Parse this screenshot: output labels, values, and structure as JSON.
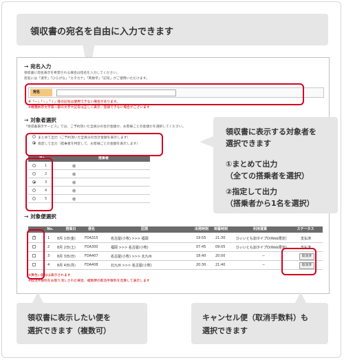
{
  "callouts": {
    "top": "領収書の宛名を自由に入力できます",
    "right": [
      "領収書に表示する対象者を",
      "選択できます",
      "①まとめて出力",
      "（全ての搭乗者を選択）",
      "②指定して出力",
      "（搭乗者から1名を選択）"
    ],
    "bottom_left": [
      "領収書に表示したい便を",
      "選択できます（複数可）"
    ],
    "bottom_right": [
      "キャンセル便（取消手数料）も",
      "選択できます"
    ]
  },
  "address_section": {
    "title": "宛名入力",
    "desc1": "領収書に宛名表示を希望される場合は宛名を入力してください。",
    "desc2": "宛名には「漢字」「ひらがな」「カタカナ」「英数字」「記号」がご使用いただけます。",
    "label": "宛名",
    "value": "",
    "note1": "※「ー」「ヽ」「ゞ」等の記号は使用できない場合があります。",
    "note2": "※機種依存文字等一部の文字や記号は正しく表示／登録できない場合がございます"
  },
  "recipient_section": {
    "title": "対象者選択",
    "desc": "「領収書表示サービス」では、ご予約頂いた全員分の合計金額か、お客様ごとの金額かを選択してください。",
    "option1": "まとめて出力（ご予約頂いた全員分の合計金額を表示します）",
    "option2": "指定して出力（搭乗者を特定して、お客様ごとの金額を表示します）",
    "header_no": "No.",
    "header_name": "搭乗者",
    "passengers": [
      {
        "no": "1",
        "name": "様",
        "selected": false
      },
      {
        "no": "2",
        "name": "様",
        "selected": false
      },
      {
        "no": "3",
        "name": "様",
        "selected": true
      },
      {
        "no": "4",
        "name": "様",
        "selected": false
      },
      {
        "no": "5",
        "name": "様",
        "selected": false
      }
    ]
  },
  "flight_section": {
    "title": "対象便選択",
    "headers": [
      "No.",
      "搭乗日",
      "便名",
      "区間",
      "出発時刻",
      "到着時刻",
      "利用運賃",
      "ステータス"
    ],
    "flights": [
      {
        "no": "1",
        "date": "8月 1日(金)",
        "flight": "FDA315",
        "route": "名古屋(小牧) >>> 福岡",
        "dep": "19:55",
        "arr": "21:30",
        "fare": "ひぃいとも割タイプD(Web限定)",
        "status": "支払済",
        "checked": true
      },
      {
        "no": "2",
        "date": "8月 2日(土)",
        "flight": "FDA300",
        "route": "福岡 >>> 名古屋(小牧)",
        "dep": "07:45",
        "arr": "09:05",
        "fare": "ひぃいとも割タイプD(Web限定)",
        "status": "支払済",
        "checked": false
      },
      {
        "no": "3",
        "date": "8月 3日(日)",
        "flight": "FDA407",
        "route": "名古屋(小牧) >>> 北九州",
        "dep": "18:40",
        "arr": "20:00",
        "fare": "−",
        "status": "取消済",
        "checked": false
      },
      {
        "no": "4",
        "date": "8月 4日(月)",
        "flight": "FDA408",
        "route": "北九州 >>> 名古屋(小牧)",
        "dep": "20:30",
        "arr": "21:40",
        "fare": "−",
        "status": "取消済",
        "checked": false
      }
    ],
    "note1": "※黄色い部分は表示されます",
    "note2": "※取消手数料をお取り消しされた場合、複数便の取消手数料を合算して表示します"
  },
  "colors": {
    "highlight": "#d2001f",
    "callout": "#e6e6e6",
    "label_orange": "#f5c77e",
    "table_header": "#6b6b6b"
  }
}
